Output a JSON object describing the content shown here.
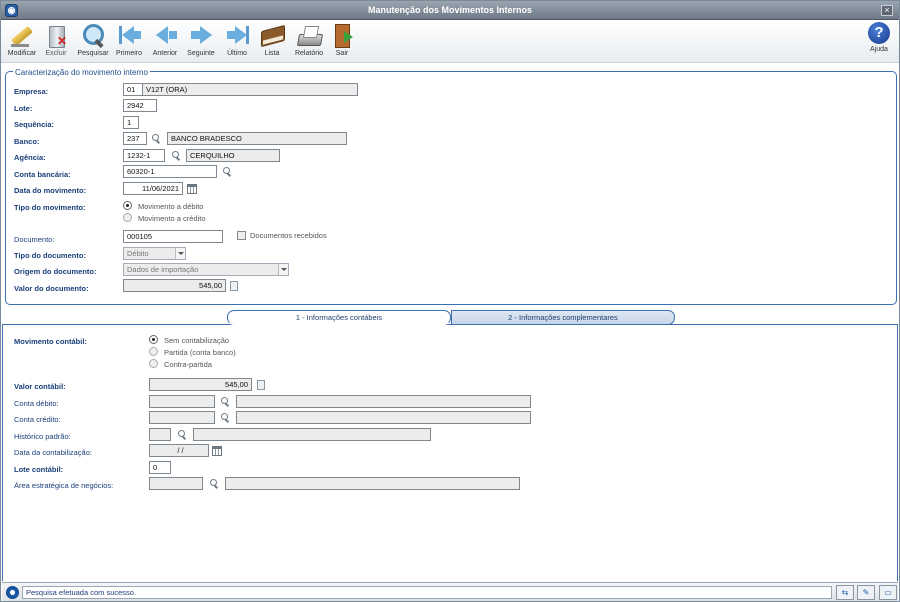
{
  "window": {
    "title": "Manutenção dos Movimentos Internos",
    "close": "×",
    "app_icon": "app-logo-icon"
  },
  "toolbar": {
    "modificar": "Modificar",
    "excluir": "Excluir",
    "pesquisar": "Pesquisar",
    "primeiro": "Primeiro",
    "anterior": "Anterior",
    "seguinte": "Seguinte",
    "ultimo": "Último",
    "lista": "Lista",
    "relatorio": "Relatório",
    "sair": "Sair",
    "ajuda": "Ajuda",
    "help_glyph": "?"
  },
  "header_section": {
    "legend": "Caracterização do movimento interno",
    "empresa": {
      "label": "Empresa:",
      "code": "01",
      "name": "V12T (ORA)"
    },
    "lote": {
      "label": "Lote:",
      "value": "2942"
    },
    "sequencia": {
      "label": "Sequência:",
      "value": "1"
    },
    "banco": {
      "label": "Banco:",
      "code": "237",
      "name": "BANCO BRADESCO"
    },
    "agencia": {
      "label": "Agência:",
      "code": "1232-1",
      "name": "CERQUILHO"
    },
    "conta": {
      "label": "Conta bancária:",
      "value": "60320-1"
    },
    "data_mov": {
      "label": "Data do movimento:",
      "value": "11/06/2021"
    },
    "tipo_mov": {
      "label": "Tipo do movimento:",
      "opt_debito": "Movimento a débito",
      "opt_credito": "Movimento a crédito",
      "selected": "debito"
    },
    "documento": {
      "label": "Documento:",
      "value": "000105",
      "recebidos": "Documentos recebidos"
    },
    "tipo_doc": {
      "label": "Tipo do documento:",
      "value": "Débito"
    },
    "origem_doc": {
      "label": "Origem do documento:",
      "value": "Dados de importação"
    },
    "valor_doc": {
      "label": "Valor do documento:",
      "value": "545,00"
    }
  },
  "tabs": [
    {
      "label": "1 - Informações contábeis",
      "active": true
    },
    {
      "label": "2 - Informações complementares",
      "active": false
    }
  ],
  "contabil": {
    "mov_label": "Movimento contábil:",
    "opt_sem": "Sem contabilização",
    "opt_partida": "Partida (conta banco)",
    "opt_contra": "Contra-partida",
    "valor": {
      "label": "Valor contábil:",
      "value": "545,00"
    },
    "debito": {
      "label": "Conta débito:"
    },
    "credito": {
      "label": "Conta crédito:"
    },
    "historico": {
      "label": "Histórico padrão:"
    },
    "data": {
      "label": "Data da contabilização:",
      "value": "/ /"
    },
    "lote": {
      "label": "Lote contábil:",
      "value": "0"
    },
    "area": {
      "label": "Área estratégica de negócios:"
    }
  },
  "status": {
    "message": "Pesquisa efetuada com sucesso."
  }
}
